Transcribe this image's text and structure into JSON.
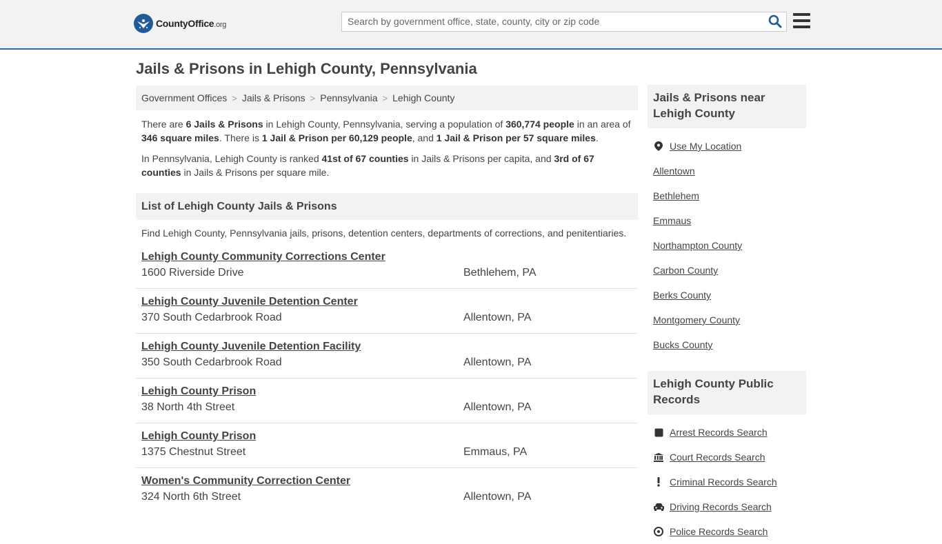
{
  "header": {
    "logo_main": "CountyOffice",
    "logo_suffix": ".org",
    "search_placeholder": "Search by government office, state, county, city or zip code"
  },
  "page_title": "Jails & Prisons in Lehigh County, Pennsylvania",
  "breadcrumb": [
    "Government Offices",
    "Jails & Prisons",
    "Pennsylvania",
    "Lehigh County"
  ],
  "intro": {
    "p1": {
      "t1": "There are ",
      "b1": "6 Jails & Prisons",
      "t2": " in Lehigh County, Pennsylvania, serving a population of ",
      "b2": "360,774 people",
      "t3": " in an area of ",
      "b3": "346 square miles",
      "t4": ". There is ",
      "b4": "1 Jail & Prison per 60,129 people",
      "t5": ", and ",
      "b5": "1 Jail & Prison per 57 square miles",
      "t6": "."
    },
    "p2": {
      "t1": "In Pennsylvania, Lehigh County is ranked ",
      "b1": "41st of 67 counties",
      "t2": " in Jails & Prisons per capita, and ",
      "b2": "3rd of 67 counties",
      "t3": " in Jails & Prisons per square mile."
    }
  },
  "list_section": {
    "heading": "List of Lehigh County Jails & Prisons",
    "description": "Find Lehigh County, Pennsylvania jails, prisons, detention centers, departments of corrections, and penitentiaries.",
    "items": [
      {
        "name": "Lehigh County Community Corrections Center",
        "address": "1600 Riverside Drive",
        "city": "Bethlehem, PA"
      },
      {
        "name": "Lehigh County Juvenile Detention Center",
        "address": "370 South Cedarbrook Road",
        "city": "Allentown, PA"
      },
      {
        "name": "Lehigh County Juvenile Detention Facility",
        "address": "350 South Cedarbrook Road",
        "city": "Allentown, PA"
      },
      {
        "name": "Lehigh County Prison",
        "address": "38 North 4th Street",
        "city": "Allentown, PA"
      },
      {
        "name": "Lehigh County Prison",
        "address": "1375 Chestnut Street",
        "city": "Emmaus, PA"
      },
      {
        "name": "Women's Community Correction Center",
        "address": "324 North 6th Street",
        "city": "Allentown, PA"
      }
    ]
  },
  "sidebar": {
    "nearby": {
      "heading": "Jails & Prisons near Lehigh County",
      "use_location": "Use My Location",
      "links": [
        "Allentown",
        "Bethlehem",
        "Emmaus",
        "Northampton County",
        "Carbon County",
        "Berks County",
        "Montgomery County",
        "Bucks County"
      ]
    },
    "records": {
      "heading": "Lehigh County Public Records",
      "links": [
        {
          "label": "Arrest Records Search",
          "icon": "square-icon"
        },
        {
          "label": "Court Records Search",
          "icon": "courthouse-icon"
        },
        {
          "label": "Criminal Records Search",
          "icon": "exclamation-icon"
        },
        {
          "label": "Driving Records Search",
          "icon": "car-icon"
        },
        {
          "label": "Police Records Search",
          "icon": "police-icon"
        }
      ]
    }
  }
}
